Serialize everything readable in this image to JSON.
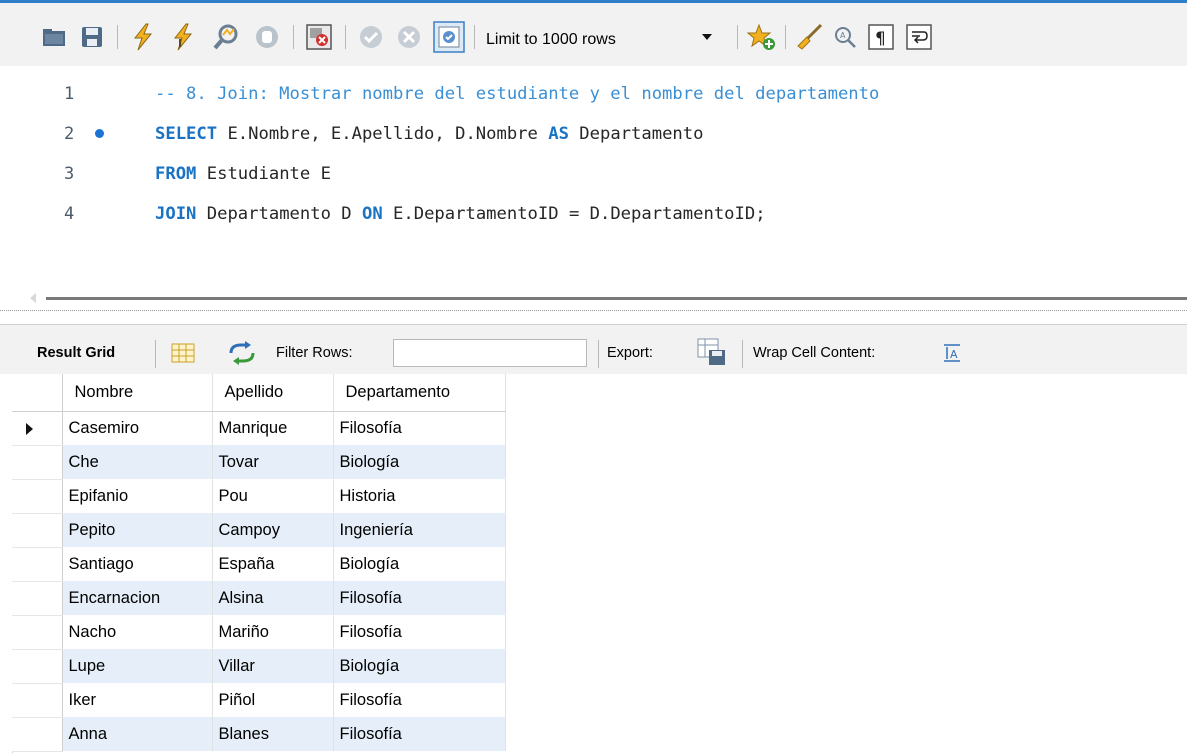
{
  "toolbar": {
    "limit_label": "Limit to 1000 rows",
    "icons": [
      "open-folder-icon",
      "save-icon",
      "execute-icon",
      "execute-current-icon",
      "explain-icon",
      "stop-icon",
      "toggle-error-icon",
      "commit-icon",
      "rollback-icon",
      "autocommit-icon",
      "beautify-star-icon",
      "brush-icon",
      "find-icon",
      "invisible-chars-icon",
      "wrap-lines-icon"
    ]
  },
  "editor": {
    "lines": [
      {
        "no": "1"
      },
      {
        "no": "2"
      },
      {
        "no": "3"
      },
      {
        "no": "4"
      }
    ],
    "line1_comment": "-- 8. Join: Mostrar nombre del estudiante y el nombre del departamento",
    "line2_kw1": "SELECT",
    "line2_text1": " E.Nombre, E.Apellido, D.Nombre ",
    "line2_kw2": "AS",
    "line2_text2": " Departamento",
    "line3_kw1": "FROM",
    "line3_text1": " Estudiante E",
    "line4_kw1": "JOIN",
    "line4_text1": " Departamento D ",
    "line4_kw2": "ON",
    "line4_text2": " E.DepartamentoID = D.DepartamentoID;"
  },
  "result_toolbar": {
    "result_grid_label": "Result Grid",
    "filter_rows_label": "Filter Rows:",
    "filter_value": "",
    "export_label": "Export:",
    "wrap_label": "Wrap Cell Content:"
  },
  "grid": {
    "columns": [
      "Nombre",
      "Apellido",
      "Departamento"
    ],
    "rows": [
      [
        "Casemiro",
        "Manrique",
        "Filosofía"
      ],
      [
        "Che",
        "Tovar",
        "Biología"
      ],
      [
        "Epifanio",
        "Pou",
        "Historia"
      ],
      [
        "Pepito",
        "Campoy",
        "Ingeniería"
      ],
      [
        "Santiago",
        "España",
        "Biología"
      ],
      [
        "Encarnacion",
        "Alsina",
        "Filosofía"
      ],
      [
        "Nacho",
        "Mariño",
        "Filosofía"
      ],
      [
        "Lupe",
        "Villar",
        "Biología"
      ],
      [
        "Iker",
        "Piñol",
        "Filosofía"
      ],
      [
        "Anna",
        "Blanes",
        "Filosofía"
      ]
    ]
  },
  "colors": {
    "keyword": "#1a72c4",
    "comment": "#3a8fd4",
    "row_stripe": "#e6eff9",
    "toolbar_bg": "#f2f2f2"
  }
}
